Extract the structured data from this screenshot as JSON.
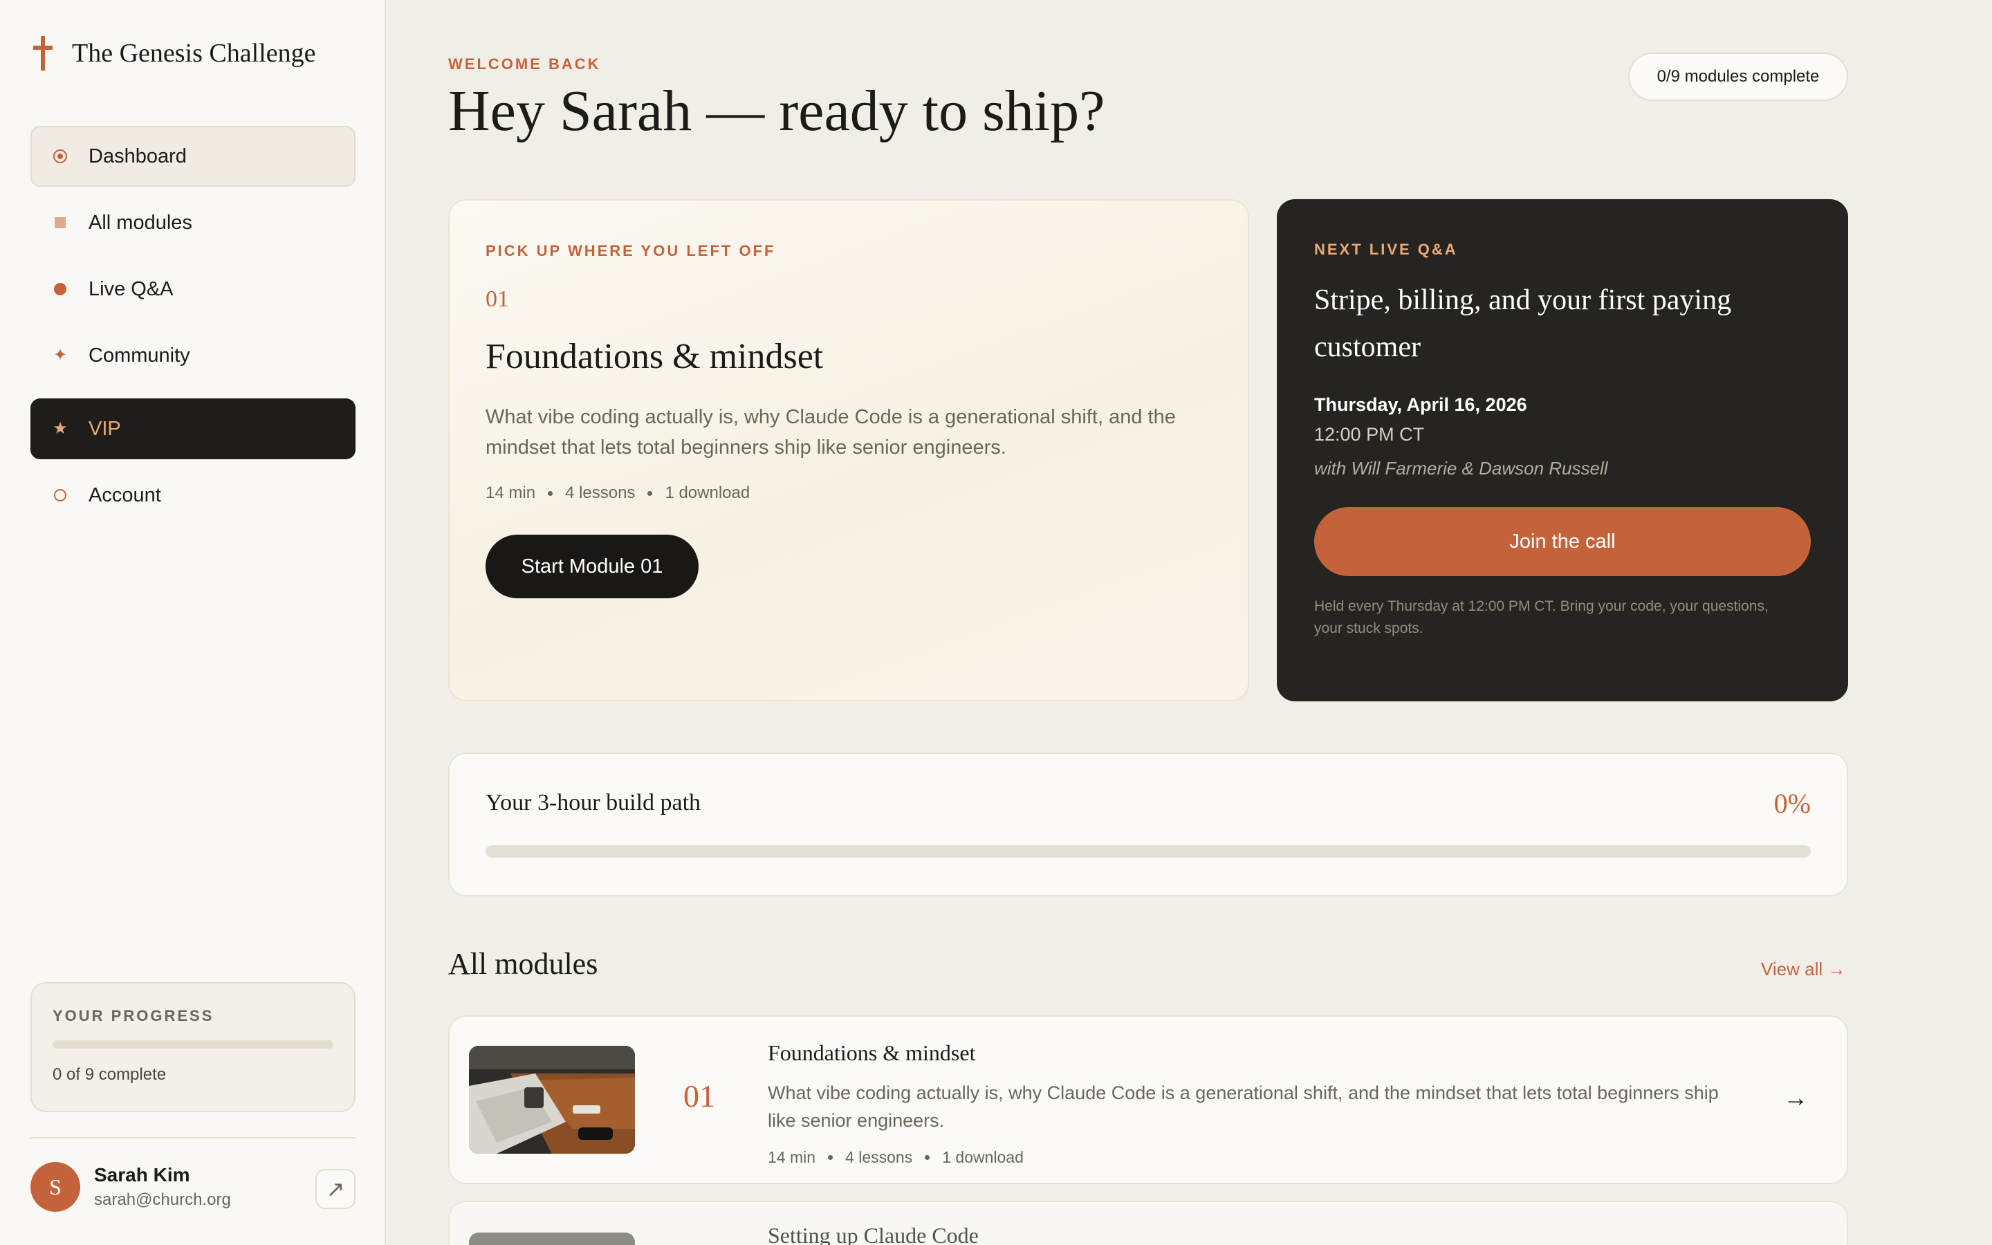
{
  "brand": {
    "title": "The Genesis Challenge",
    "icon": "cross-icon"
  },
  "sidebar": {
    "items": [
      {
        "label": "Dashboard",
        "icon": "target-icon",
        "active": true
      },
      {
        "label": "All modules",
        "icon": "square-icon"
      },
      {
        "label": "Live Q&A",
        "icon": "dot-icon"
      },
      {
        "label": "Community",
        "icon": "sparkle-icon"
      },
      {
        "label": "VIP",
        "icon": "star-icon"
      },
      {
        "label": "Account",
        "icon": "ring-icon"
      }
    ],
    "progress": {
      "label": "YOUR PROGRESS",
      "text": "0 of 9 complete",
      "fraction": 0
    },
    "user": {
      "initial": "S",
      "name": "Sarah Kim",
      "email": "sarah@church.org"
    }
  },
  "header": {
    "eyebrow": "WELCOME BACK",
    "title": "Hey Sarah — ready to ship?",
    "modules_pill": "0/9 modules complete"
  },
  "continue_card": {
    "eyebrow": "PICK UP WHERE YOU LEFT OFF",
    "number": "01",
    "title": "Foundations & mindset",
    "description": "What vibe coding actually is, why Claude Code is a generational shift, and the mindset that lets total beginners ship like senior engineers.",
    "meta": [
      "14 min",
      "4 lessons",
      "1 download"
    ],
    "button": "Start Module 01"
  },
  "live_qa": {
    "eyebrow": "NEXT LIVE Q&A",
    "title": "Stripe, billing, and your first paying customer",
    "date": "Thursday, April 16, 2026",
    "time": "12:00 PM CT",
    "hosts": "with Will Farmerie & Dawson Russell",
    "button": "Join the call",
    "note": "Held every Thursday at 12:00 PM CT. Bring your code, your questions, your stuck spots."
  },
  "build_path": {
    "title": "Your 3-hour build path",
    "percent_label": "0%",
    "percent": 0
  },
  "modules": {
    "title": "All modules",
    "view_all": "View all →",
    "items": [
      {
        "number": "01",
        "title": "Foundations & mindset",
        "description": "What vibe coding actually is, why Claude Code is a generational shift, and the mindset that lets total beginners ship like senior engineers.",
        "meta": [
          "14 min",
          "4 lessons",
          "1 download"
        ]
      },
      {
        "number": "",
        "title": "Setting up Claude Code",
        "description": "",
        "meta": []
      }
    ]
  },
  "colors": {
    "accent": "#c4633b",
    "dark": "#1f1d1a",
    "vip_text": "#e9a977",
    "background": "#f1eee8"
  }
}
